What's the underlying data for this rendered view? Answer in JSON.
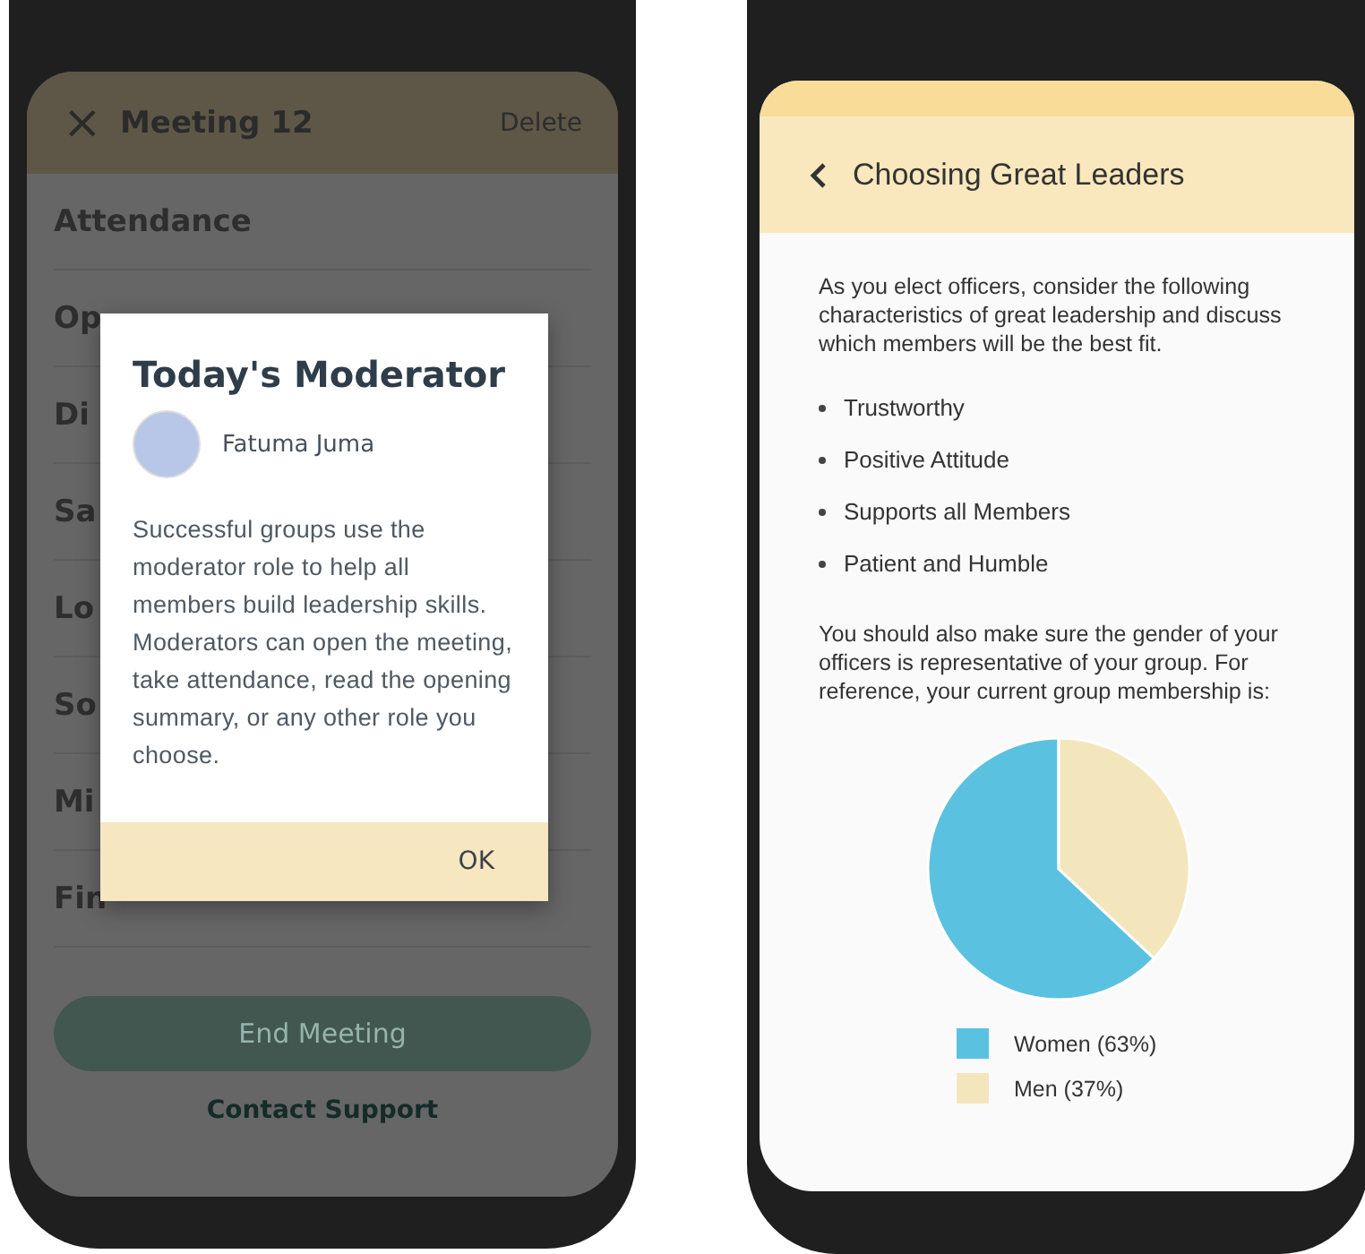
{
  "meeting_screen": {
    "header": {
      "close_icon": "×",
      "title": "Meeting 12",
      "action": "Delete"
    },
    "items": [
      {
        "label": "Attendance"
      },
      {
        "label": "Op"
      },
      {
        "label": "Di"
      },
      {
        "label": "Sa"
      },
      {
        "label": "Lo"
      },
      {
        "label": "So"
      },
      {
        "label": "Mi"
      },
      {
        "label": "Fin"
      }
    ],
    "end_button": {
      "label": "End Meeting",
      "disabled": true
    },
    "support_link": "Contact Support",
    "dialog": {
      "title": "Today's Moderator",
      "moderator": "Fatuma Juma",
      "body": "Successful groups use the moderator role to help all members build leadership skills. Moderators can open the meeting, take attendance, read the opening summary, or any other role you choose.",
      "button": "OK"
    }
  },
  "leaders_screen": {
    "header": {
      "title": "Choosing Great Leaders"
    },
    "intro": "As you elect officers, consider the following characteristics of great leadership and discuss which members will be the best fit.",
    "traits": [
      "Trustworthy",
      "Positive Attitude",
      "Supports all Members",
      "Patient and Humble"
    ],
    "note": "You should also make sure the gender of your officers is representative of your group. For reference, your current group membership is:",
    "chart_data": {
      "type": "pie",
      "categories": [
        "Women",
        "Men"
      ],
      "values": [
        63,
        37
      ]
    },
    "legend": [
      {
        "share": "(63%)",
        "color": "#5bc1e1"
      },
      {
        "share": "(37%)",
        "color": "#f3e6bd"
      }
    ]
  }
}
